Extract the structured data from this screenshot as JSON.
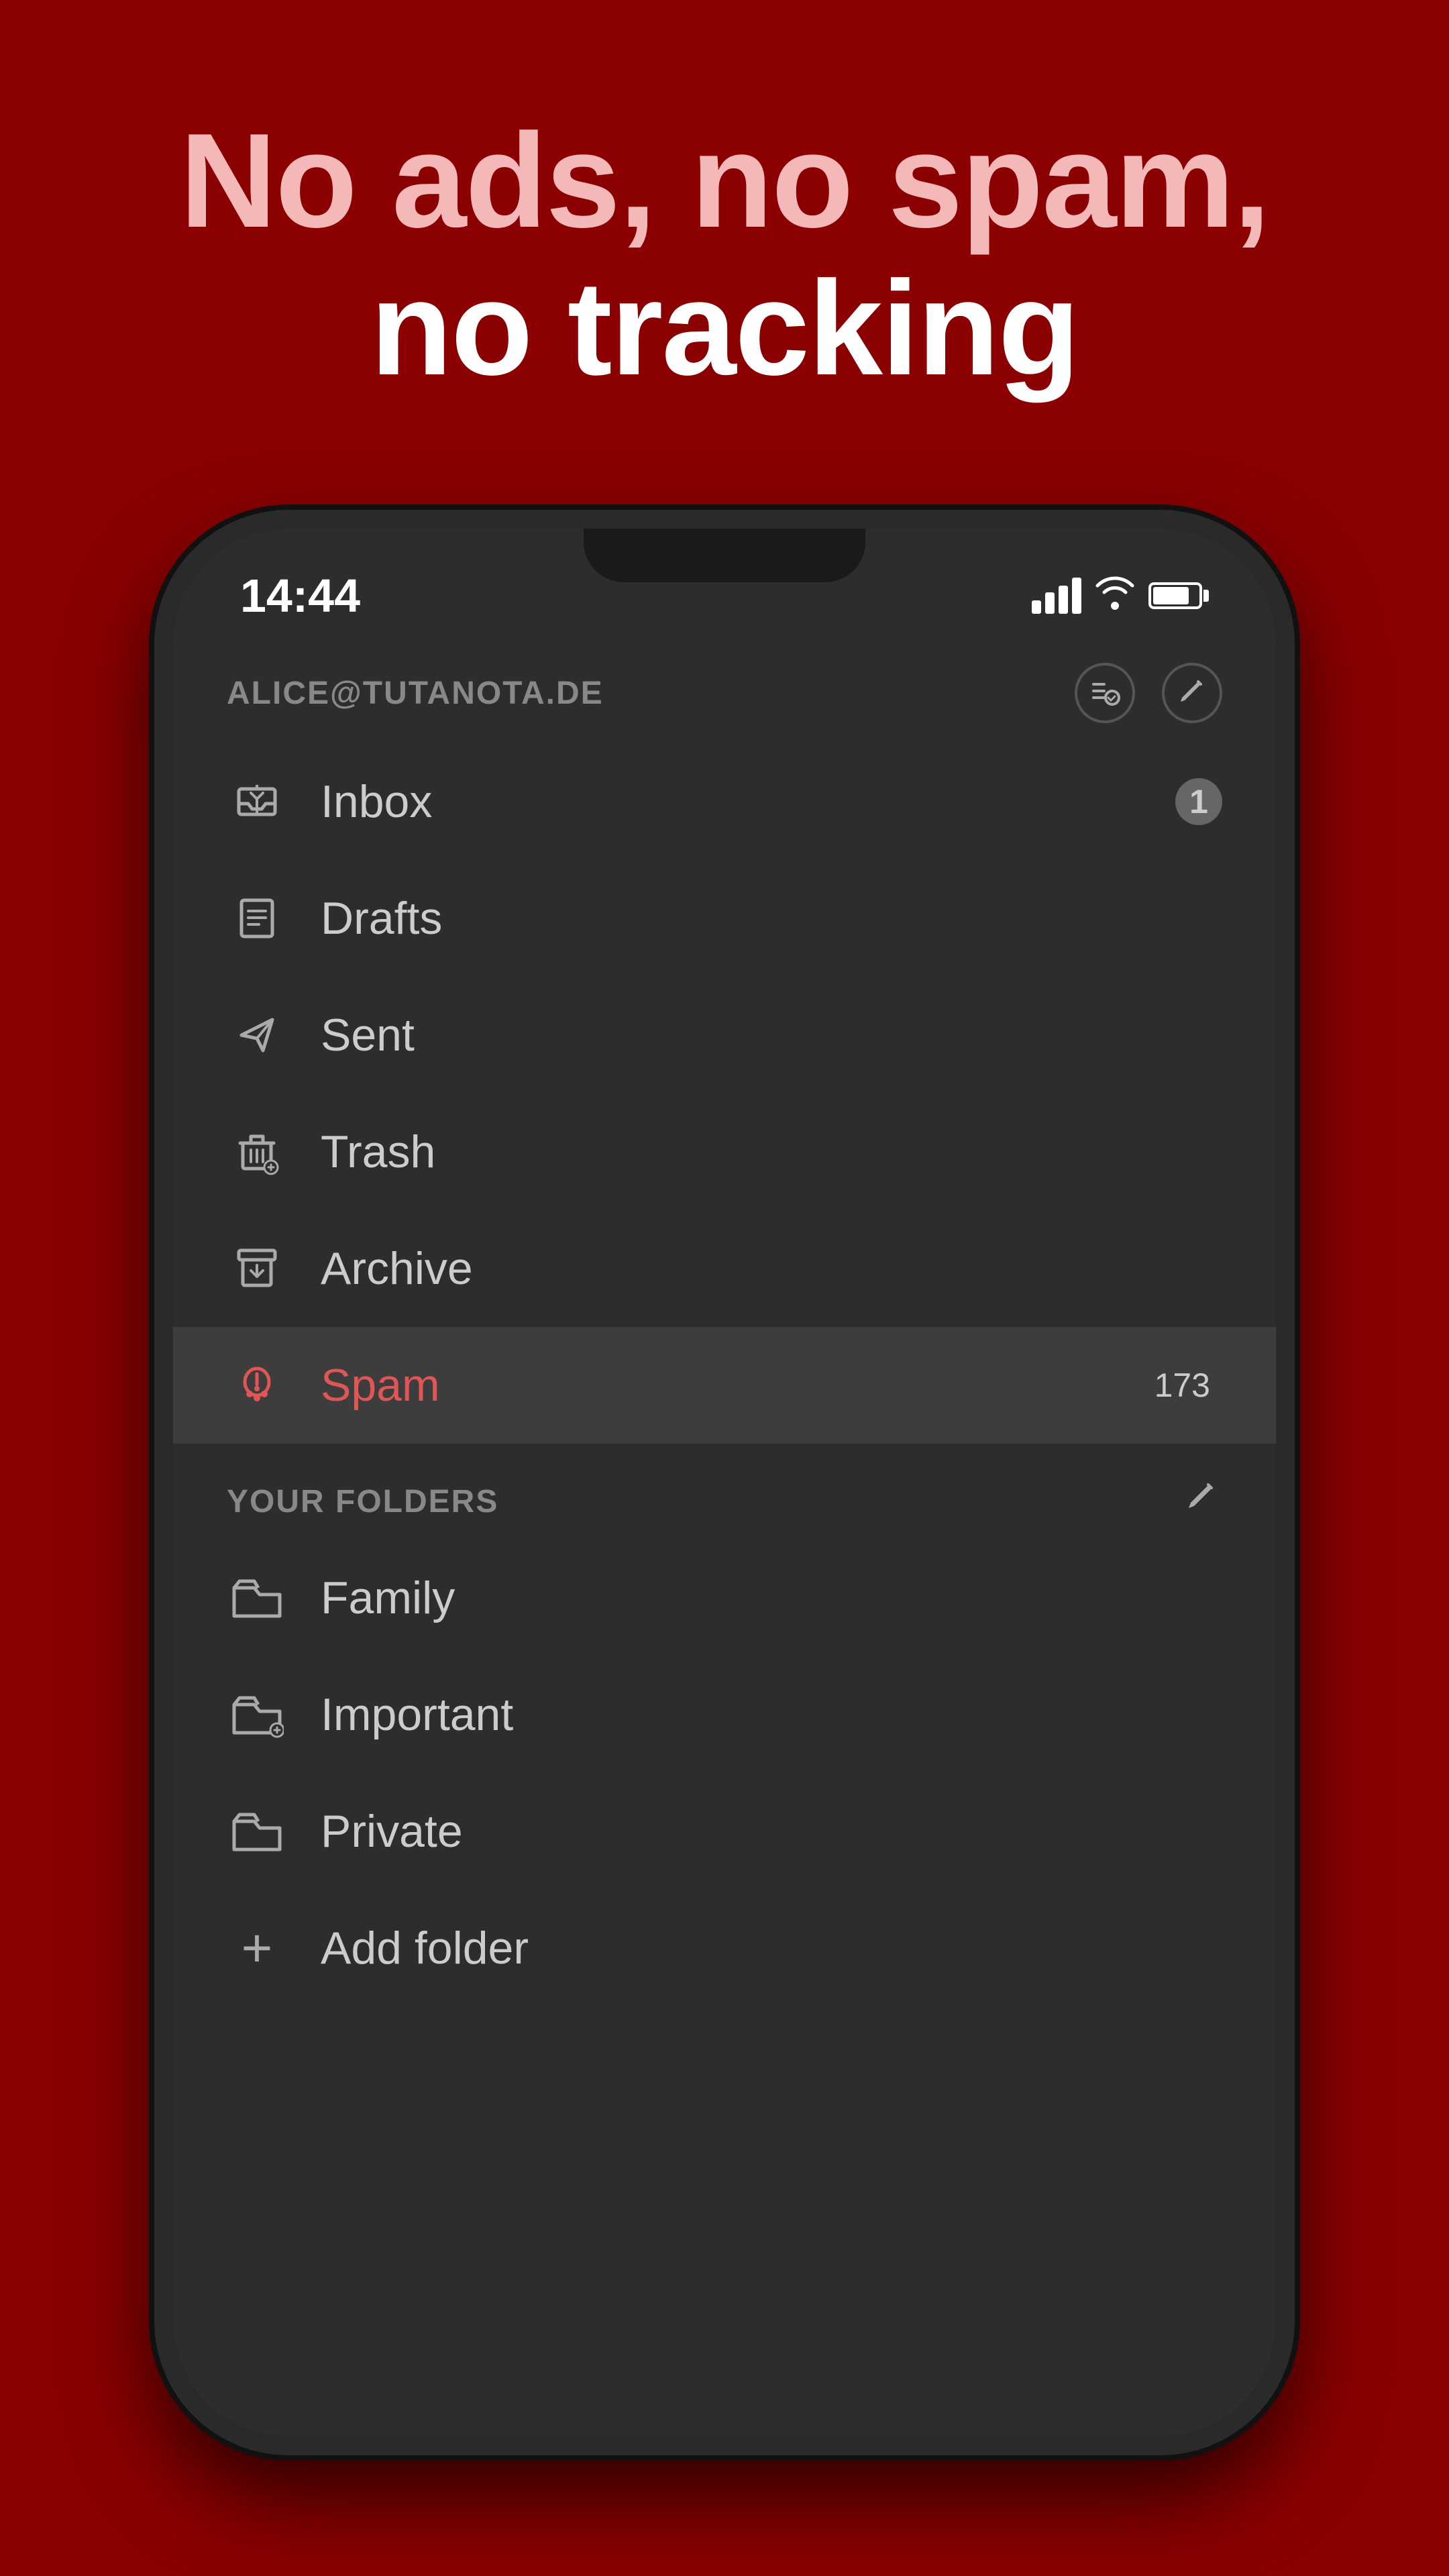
{
  "headline": {
    "line1": "No ads, no spam,",
    "line2": "no tracking"
  },
  "statusBar": {
    "time": "14:44",
    "signalBars": [
      1,
      2,
      3,
      4
    ],
    "battery": 80
  },
  "drawer": {
    "account": "ALICE@TUTANOTA.DE",
    "headerIcons": [
      "checklist-icon",
      "compose-icon"
    ],
    "menuItems": [
      {
        "id": "inbox",
        "label": "Inbox",
        "badge": "1",
        "active": false
      },
      {
        "id": "drafts",
        "label": "Drafts",
        "badge": null,
        "active": false
      },
      {
        "id": "sent",
        "label": "Sent",
        "badge": null,
        "active": false
      },
      {
        "id": "trash",
        "label": "Trash",
        "badge": null,
        "active": false
      },
      {
        "id": "archive",
        "label": "Archive",
        "badge": null,
        "active": false
      },
      {
        "id": "spam",
        "label": "Spam",
        "badge": "173",
        "active": true
      }
    ],
    "foldersSection": {
      "title": "YOUR FOLDERS",
      "editLabel": "✏️",
      "folders": [
        {
          "id": "family",
          "label": "Family"
        },
        {
          "id": "important",
          "label": "Important"
        },
        {
          "id": "private",
          "label": "Private"
        }
      ],
      "addFolder": "Add folder"
    }
  }
}
